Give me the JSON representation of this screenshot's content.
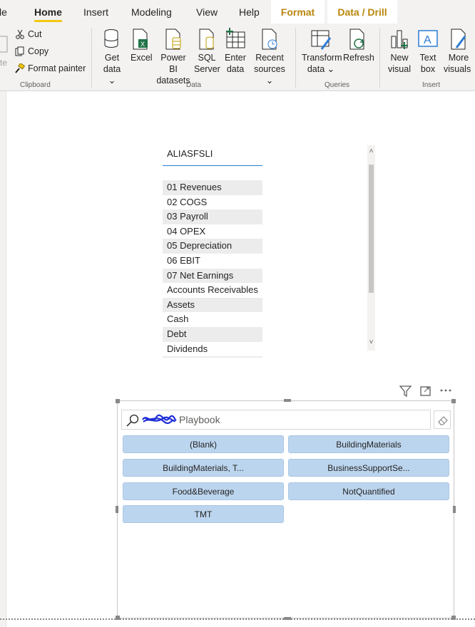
{
  "tabs": {
    "file_partial": "le",
    "home": "Home",
    "insert": "Insert",
    "modeling": "Modeling",
    "view": "View",
    "help": "Help",
    "format": "Format",
    "data_drill": "Data / Drill"
  },
  "clipboard": {
    "paste_partial": "te",
    "cut": "Cut",
    "copy": "Copy",
    "format_painter": "Format painter",
    "group": "Clipboard"
  },
  "data_group": {
    "get_data": [
      "Get",
      "data"
    ],
    "excel": "Excel",
    "power_bi": [
      "Power BI",
      "datasets"
    ],
    "sql": [
      "SQL",
      "Server"
    ],
    "enter": [
      "Enter",
      "data"
    ],
    "recent": [
      "Recent",
      "sources"
    ],
    "group": "Data"
  },
  "queries_group": {
    "transform": [
      "Transform",
      "data"
    ],
    "refresh": "Refresh",
    "group": "Queries"
  },
  "insert_group": {
    "new_visual": [
      "New",
      "visual"
    ],
    "text_box": [
      "Text",
      "box"
    ],
    "more_visuals": [
      "More",
      "visuals"
    ],
    "group": "Insert"
  },
  "table": {
    "header": "ALIASFSLI",
    "rows": [
      "01 Revenues",
      "02 COGS",
      "03 Payroll",
      "04 OPEX",
      "05 Depreciation",
      "06 EBIT",
      "07 Net Earnings",
      "Accounts Receivables",
      "Assets",
      "Cash",
      "Debt",
      "Dividends"
    ]
  },
  "slicer": {
    "search_text": "Playbook",
    "chips": [
      "(Blank)",
      "BuildingMaterials",
      "BuildingMaterials, T...",
      "BusinessSupportSe...",
      "Food&Beverage",
      "NotQuantified",
      "TMT"
    ]
  },
  "colors": {
    "accent_yellow": "#f2c811",
    "chip_blue": "#bcd5ee",
    "header_underline": "#2b7cd3"
  }
}
